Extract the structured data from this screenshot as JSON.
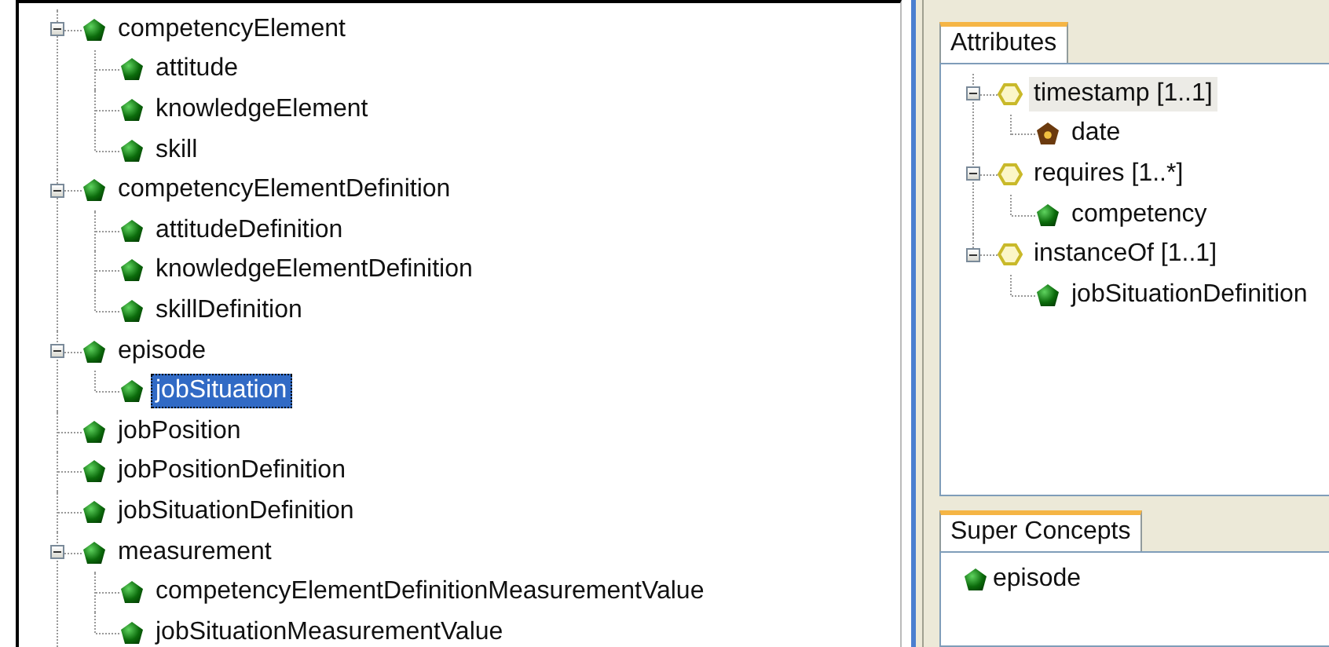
{
  "concept_tree": [
    {
      "label": "competencyElement",
      "kind": "class",
      "expanded": true,
      "selected": false,
      "children": [
        {
          "label": "attitude",
          "kind": "class",
          "selected": false
        },
        {
          "label": "knowledgeElement",
          "kind": "class",
          "selected": false
        },
        {
          "label": "skill",
          "kind": "class",
          "selected": false
        }
      ]
    },
    {
      "label": "competencyElementDefinition",
      "kind": "class",
      "expanded": true,
      "selected": false,
      "children": [
        {
          "label": "attitudeDefinition",
          "kind": "class",
          "selected": false
        },
        {
          "label": "knowledgeElementDefinition",
          "kind": "class",
          "selected": false
        },
        {
          "label": "skillDefinition",
          "kind": "class",
          "selected": false
        }
      ]
    },
    {
      "label": "episode",
      "kind": "class",
      "expanded": true,
      "selected": false,
      "children": [
        {
          "label": "jobSituation",
          "kind": "class",
          "selected": true
        }
      ]
    },
    {
      "label": "jobPosition",
      "kind": "class",
      "selected": false
    },
    {
      "label": "jobPositionDefinition",
      "kind": "class",
      "selected": false
    },
    {
      "label": "jobSituationDefinition",
      "kind": "class",
      "selected": false
    },
    {
      "label": "measurement",
      "kind": "class",
      "expanded": true,
      "selected": false,
      "children": [
        {
          "label": "competencyElementDefinitionMeasurementValue",
          "kind": "class",
          "selected": false
        },
        {
          "label": "jobSituationMeasurementValue",
          "kind": "class",
          "selected": false
        }
      ]
    }
  ],
  "attributes_panel": {
    "tab": "Attributes",
    "tree": [
      {
        "label": "timestamp [1..1]",
        "kind": "slot",
        "expanded": true,
        "selected": true,
        "children": [
          {
            "label": "date",
            "kind": "datatype",
            "selected": false
          }
        ]
      },
      {
        "label": "requires [1..*]",
        "kind": "slot",
        "expanded": true,
        "selected": false,
        "children": [
          {
            "label": "competency",
            "kind": "class",
            "selected": false
          }
        ]
      },
      {
        "label": "instanceOf [1..1]",
        "kind": "slot",
        "expanded": true,
        "selected": false,
        "children": [
          {
            "label": "jobSituationDefinition",
            "kind": "class",
            "selected": false
          }
        ]
      }
    ]
  },
  "super_concepts_panel": {
    "tab": "Super Concepts",
    "items": [
      {
        "label": "episode",
        "kind": "class"
      }
    ]
  }
}
